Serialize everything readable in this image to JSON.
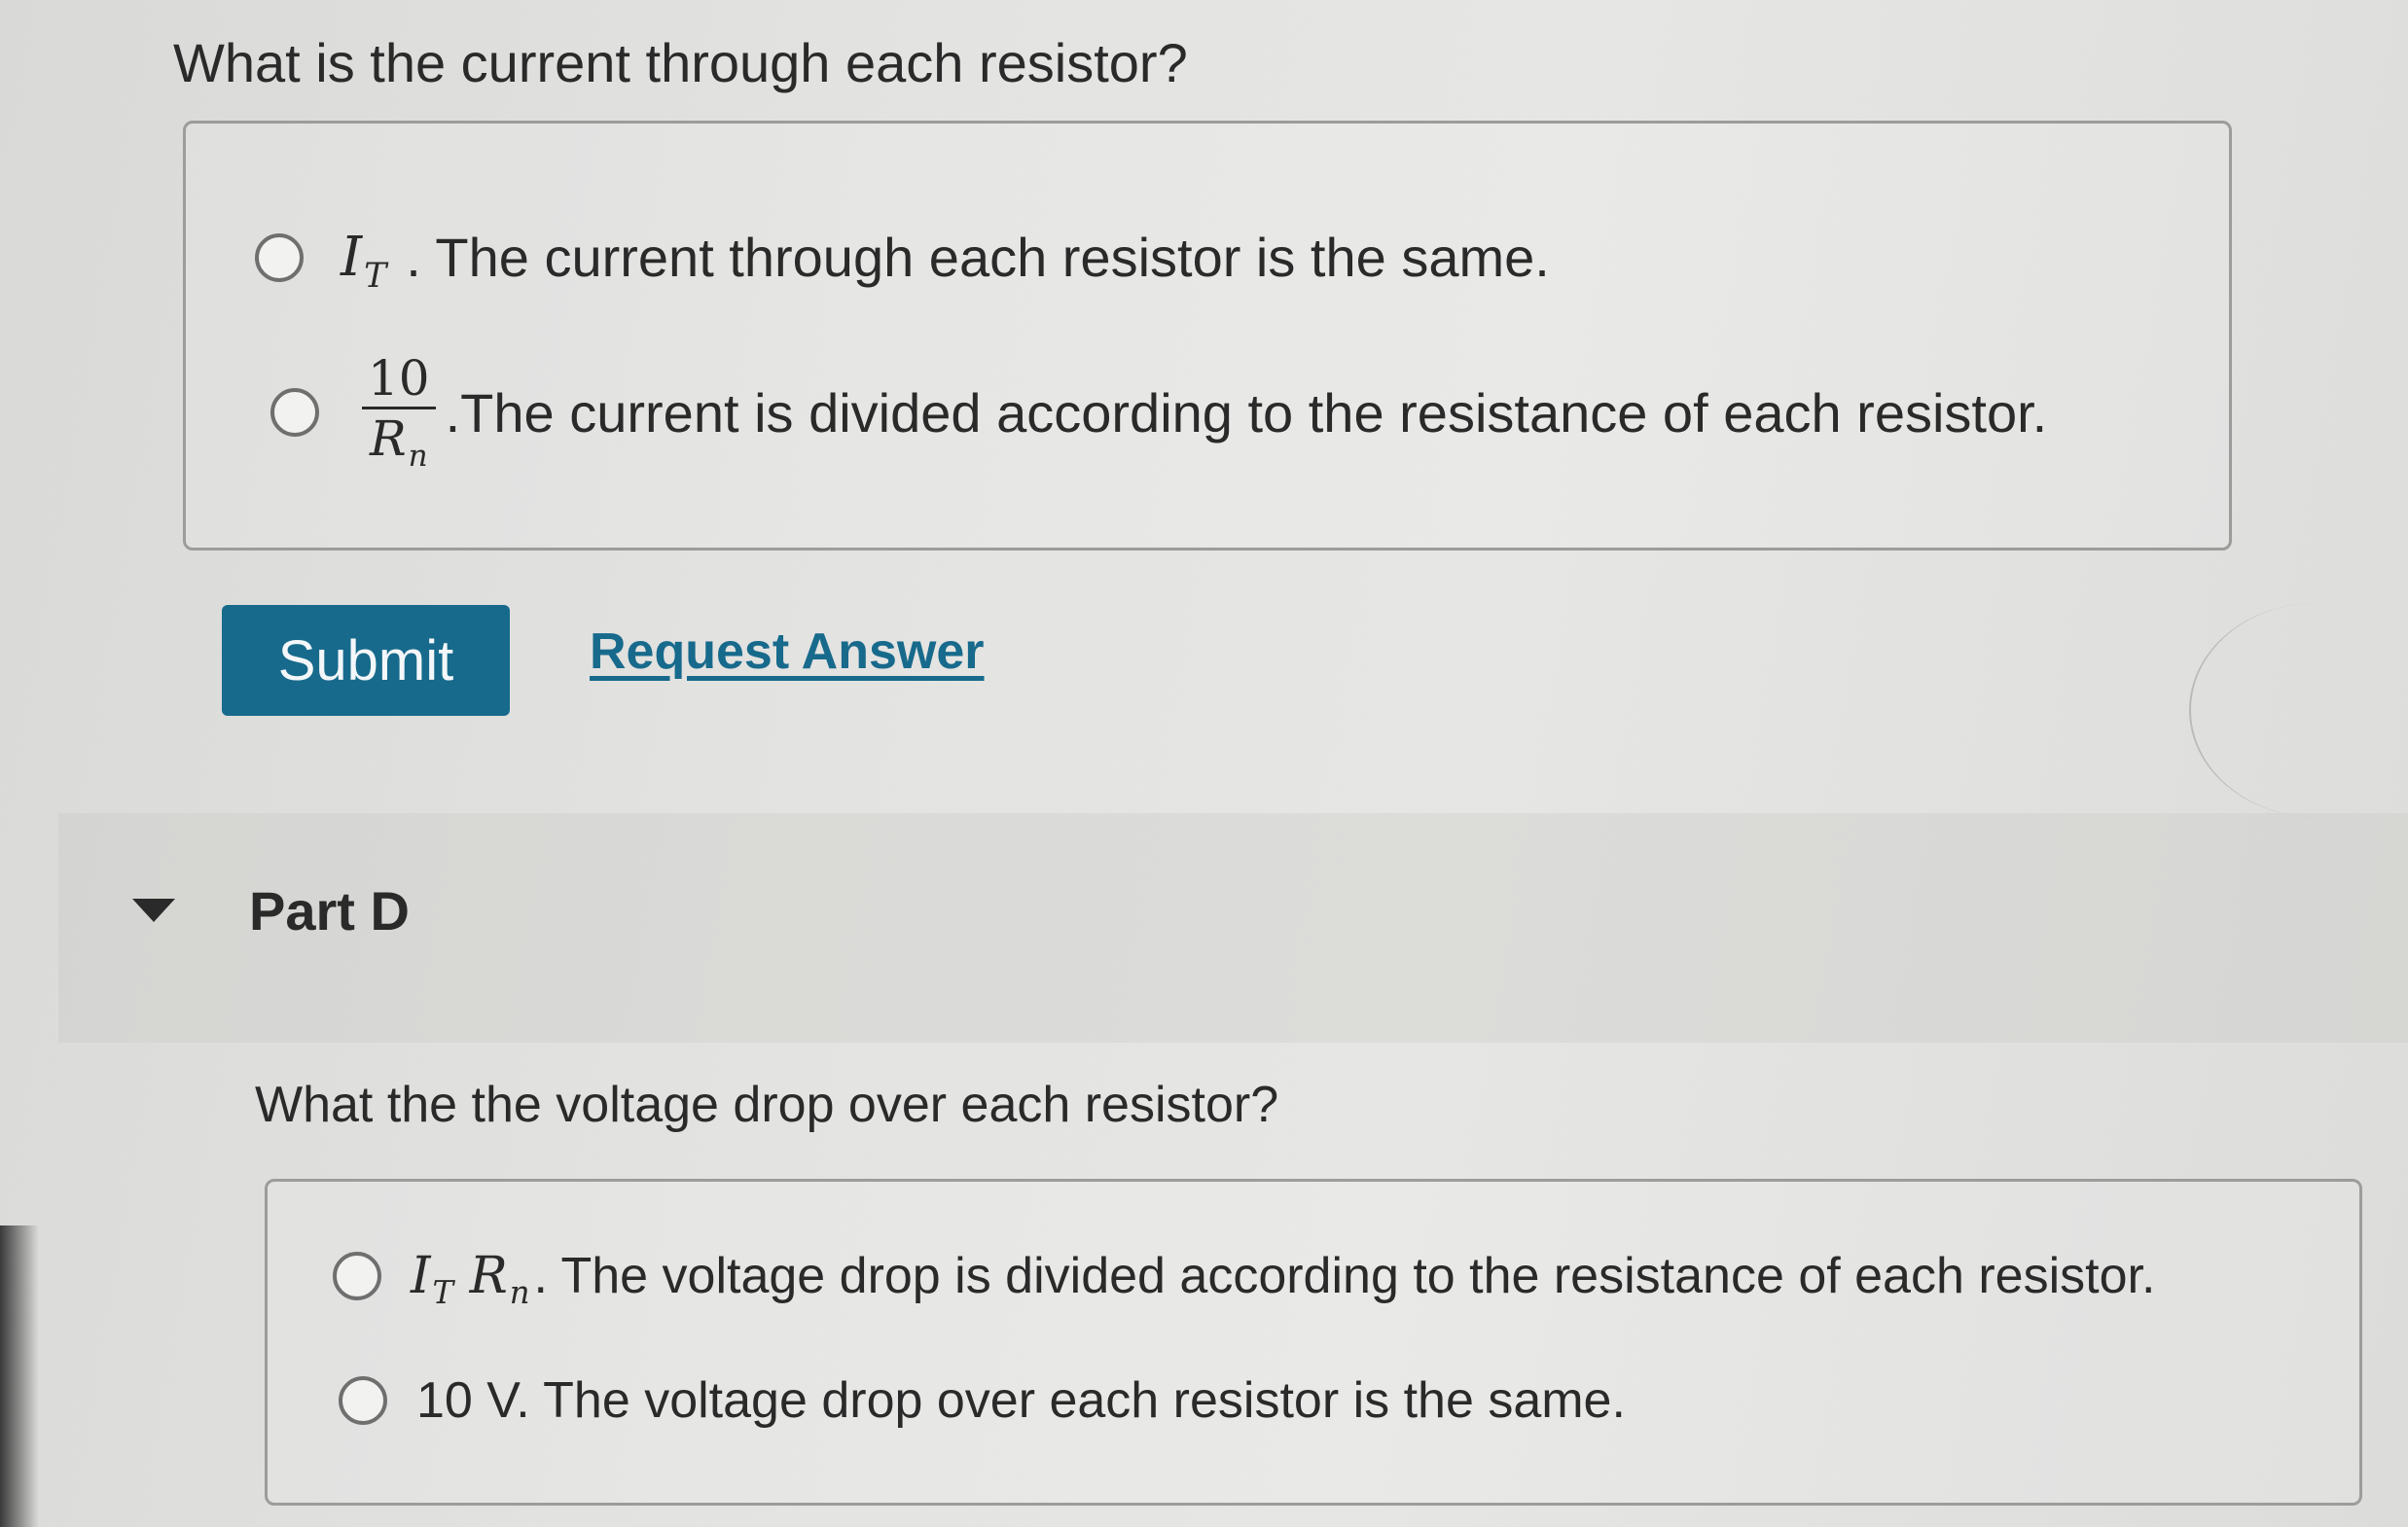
{
  "part_c": {
    "question": "What is the current through each resistor?",
    "options": [
      {
        "math_main": "I",
        "math_sub": "T",
        "text": ". The current through each resistor is the same."
      },
      {
        "frac_num": "10",
        "frac_den_main": "R",
        "frac_den_sub": "n",
        "text": ".The current is divided according to the resistance of each resistor."
      }
    ]
  },
  "actions": {
    "submit_label": "Submit",
    "request_answer_label": "Request Answer"
  },
  "part_d": {
    "title": "Part D",
    "question": "What the the voltage drop over each resistor?",
    "options": [
      {
        "math_i": "I",
        "math_i_sub": "T",
        "math_r": "R",
        "math_r_sub": "n",
        "text": ". The voltage drop is divided according to the resistance of each resistor."
      },
      {
        "text": "10 V. The voltage drop over each resistor is the same."
      }
    ]
  },
  "colors": {
    "accent": "#176a8c",
    "background": "#e3e3e1",
    "border": "#9c9c9a"
  },
  "icons": {
    "collapse": "caret-down-icon",
    "radio": "radio-unchecked-icon"
  }
}
